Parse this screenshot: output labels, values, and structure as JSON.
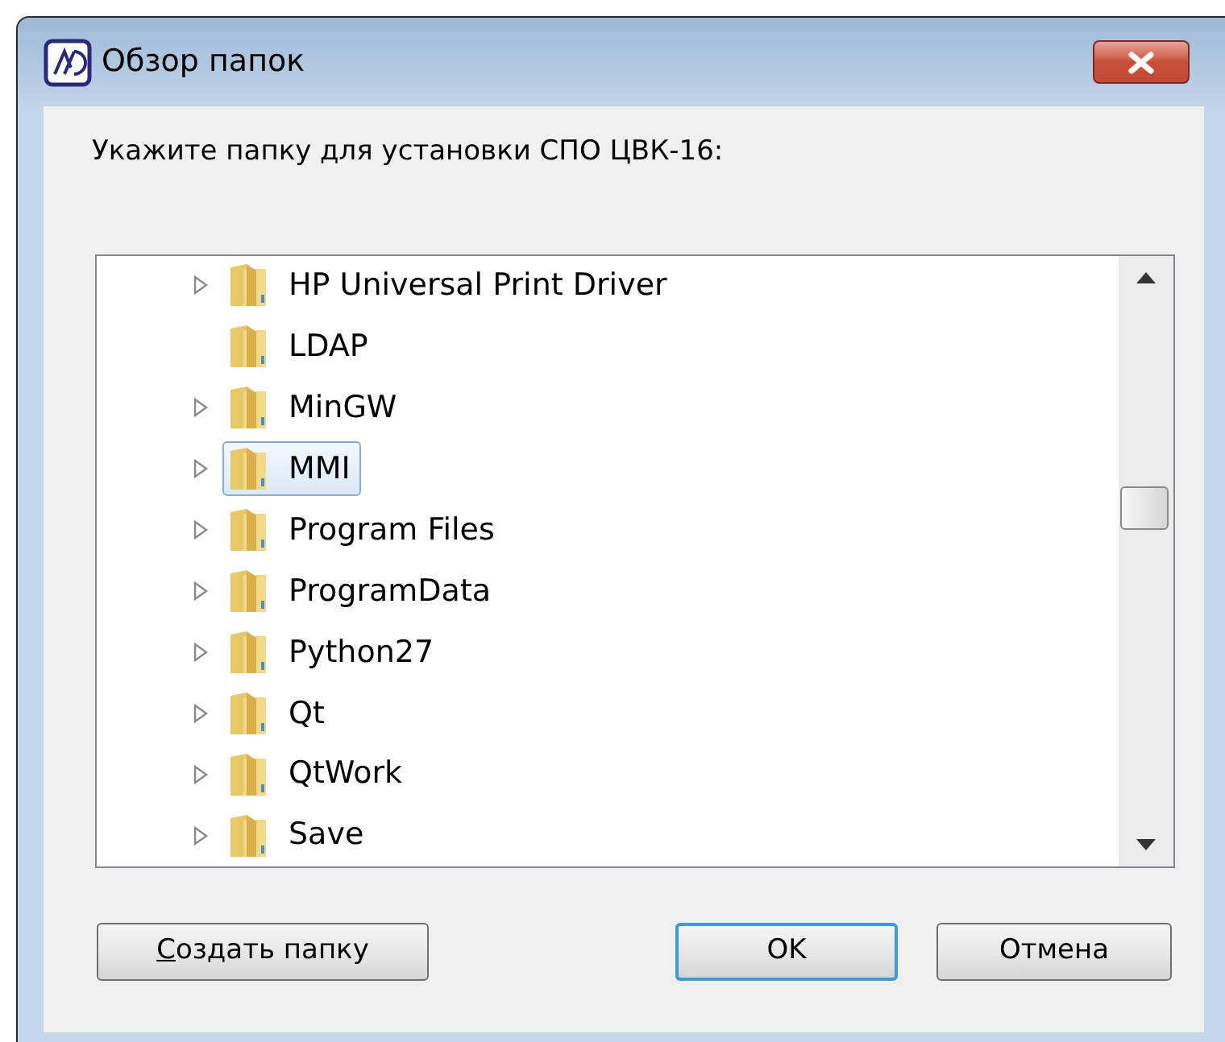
{
  "window": {
    "title": "Обзор папок"
  },
  "prompt": "Укажите папку для установки СПО ЦВК-16:",
  "tree": {
    "items": [
      {
        "label": "HP Universal Print Driver",
        "expandable": true,
        "selected": false
      },
      {
        "label": "LDAP",
        "expandable": false,
        "selected": false
      },
      {
        "label": "MinGW",
        "expandable": true,
        "selected": false
      },
      {
        "label": "MMI",
        "expandable": true,
        "selected": true
      },
      {
        "label": "Program Files",
        "expandable": true,
        "selected": false
      },
      {
        "label": "ProgramData",
        "expandable": true,
        "selected": false
      },
      {
        "label": "Python27",
        "expandable": true,
        "selected": false
      },
      {
        "label": "Qt",
        "expandable": true,
        "selected": false
      },
      {
        "label": "QtWork",
        "expandable": true,
        "selected": false
      },
      {
        "label": "Save",
        "expandable": true,
        "selected": false
      }
    ]
  },
  "buttons": [
    {
      "label": "Создать папку",
      "kind": "left",
      "mnemonic_first": true,
      "default": false
    },
    {
      "label": "OK",
      "kind": "right",
      "mnemonic_first": false,
      "default": true
    },
    {
      "label": "Отмена",
      "kind": "right",
      "mnemonic_first": false,
      "default": false
    }
  ]
}
